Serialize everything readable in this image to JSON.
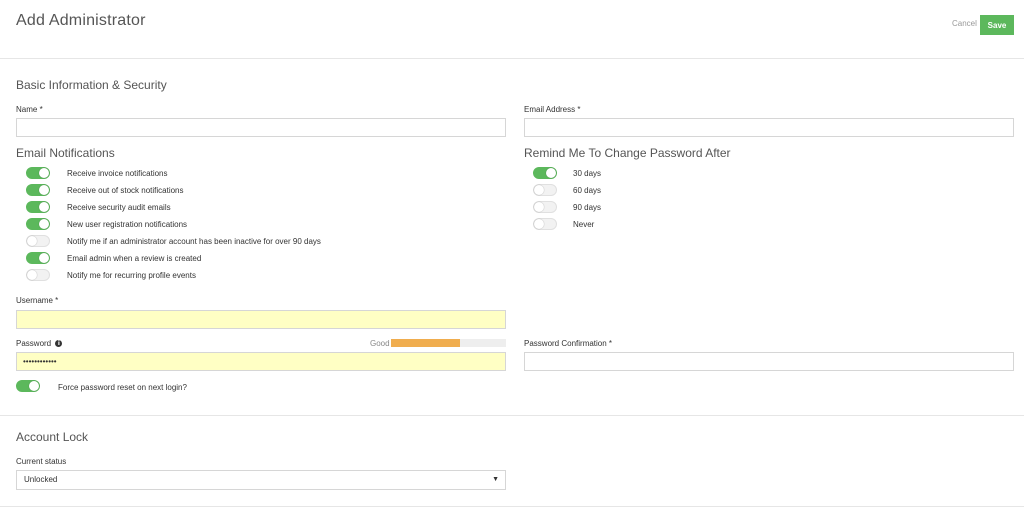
{
  "header": {
    "title": "Add Administrator",
    "cancel_label": "Cancel",
    "save_label": "Save"
  },
  "basic_info": {
    "title": "Basic Information & Security",
    "name_label": "Name *",
    "name_value": "",
    "email_label": "Email Address *",
    "email_value": ""
  },
  "email_notifications": {
    "title": "Email Notifications",
    "items": [
      {
        "label": "Receive invoice notifications",
        "on": true
      },
      {
        "label": "Receive out of stock notifications",
        "on": true
      },
      {
        "label": "Receive security audit emails",
        "on": true
      },
      {
        "label": "New user registration notifications",
        "on": true
      },
      {
        "label": "Notify me if an administrator account has been inactive for over 90 days",
        "on": false
      },
      {
        "label": "Email admin when a review is created",
        "on": true
      },
      {
        "label": "Notify me for recurring profile events",
        "on": false
      }
    ]
  },
  "password_reminder": {
    "title": "Remind Me To Change Password After",
    "items": [
      {
        "label": "30 days",
        "on": true
      },
      {
        "label": "60 days",
        "on": false
      },
      {
        "label": "90 days",
        "on": false
      },
      {
        "label": "Never",
        "on": false
      }
    ]
  },
  "credentials": {
    "username_label": "Username *",
    "username_value": "",
    "password_label": "Password",
    "password_value": "••••••••••••",
    "strength_label": "Good",
    "strength_fraction": 0.6,
    "confirm_label": "Password Confirmation *",
    "confirm_value": "",
    "force_reset_label": "Force password reset on next login?",
    "force_reset_on": true
  },
  "account_lock": {
    "title": "Account Lock",
    "status_label": "Current status",
    "status_value": "Unlocked"
  },
  "colors": {
    "accent": "#5cb85c",
    "strength": "#f0ad4e",
    "autofill": "#ffffc4"
  }
}
